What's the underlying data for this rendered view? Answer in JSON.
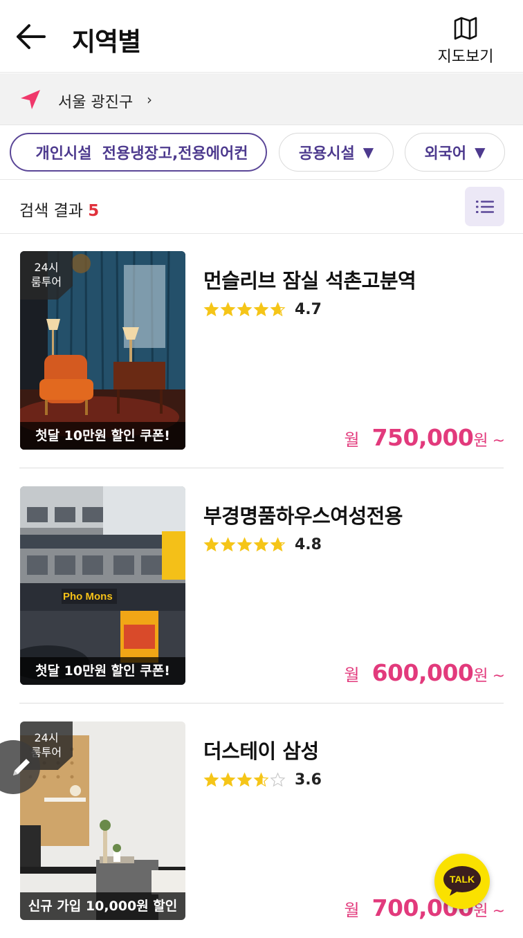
{
  "header": {
    "title": "지역별",
    "map_label": "지도보기"
  },
  "location": {
    "text": "서울 광진구",
    "chevron": "›"
  },
  "filters": [
    {
      "label": "개인시설  전용냉장고,전용에어컨",
      "active": true
    },
    {
      "label": "공용시설",
      "caret": "▼"
    },
    {
      "label": "외국어",
      "caret": "▼"
    }
  ],
  "results": {
    "label": "검색 결과",
    "count": "5"
  },
  "listings": [
    {
      "title": "먼슬리브 잠실 석촌고분역",
      "rating": "4.7",
      "rating_value": 4.7,
      "badge": [
        "24시",
        "룸투어"
      ],
      "coupon": "첫달 10만원 할인 쿠폰!",
      "price_prefix": "월",
      "price": "750,000",
      "price_unit": "원",
      "price_suffix": "~"
    },
    {
      "title": "부경명품하우스여성전용",
      "rating": "4.8",
      "rating_value": 4.8,
      "badge": null,
      "coupon": "첫달 10만원 할인 쿠폰!",
      "sign_text": "Pho Mons",
      "price_prefix": "월",
      "price": "600,000",
      "price_unit": "원",
      "price_suffix": "~"
    },
    {
      "title": "더스테이 삼성",
      "rating": "3.6",
      "rating_value": 3.6,
      "badge": [
        "24시",
        "룸투어"
      ],
      "coupon": "신규 가입 10,000원 할인",
      "price_prefix": "월",
      "price": "700,000",
      "price_unit": "원",
      "price_suffix": "~"
    }
  ],
  "talk_label": "TALK",
  "colors": {
    "accent_purple": "#5a4697",
    "price_pink": "#e23a7c",
    "count_red": "#e0313b",
    "star_gold": "#f5c518",
    "talk_yellow": "#fae100",
    "location_pink": "#f0386b"
  }
}
